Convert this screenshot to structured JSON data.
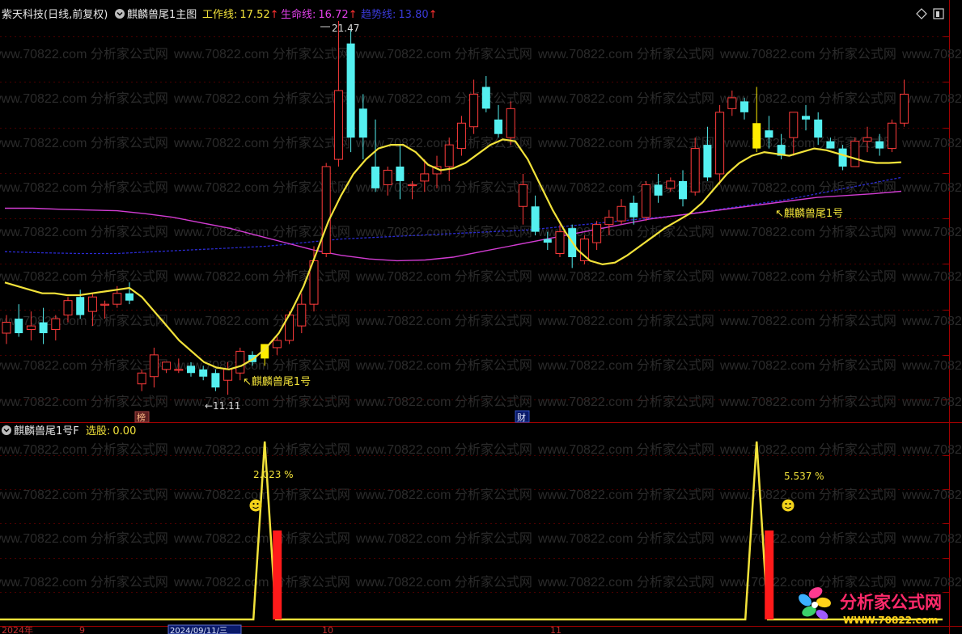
{
  "main_panel": {
    "stock": "紫天科技(日线,前复权)",
    "indicator": "麒麟兽尾1主图",
    "work_line": {
      "label": "工作线:",
      "value": "17.52",
      "arrow": "↑",
      "color": "#f2e23a"
    },
    "life_line": {
      "label": "生命线:",
      "value": "16.72",
      "arrow": "↑",
      "color": "#e040e8"
    },
    "trend_line": {
      "label": "趋势线:",
      "value": "13.80",
      "arrow": "↑",
      "color": "#3a3ad8"
    },
    "high_marker": "21.47",
    "low_marker": "←11.11",
    "signal_labels": [
      "↖麒麟兽尾1号",
      "↖麒麟兽尾1号"
    ],
    "event_tags": [
      "榜",
      "财"
    ]
  },
  "sub_panel": {
    "indicator": "麒麟兽尾1号F",
    "select_label": "选股:",
    "select_value": "0.00",
    "peak_labels": [
      "2.023 %",
      "5.537 %"
    ]
  },
  "time_axis": {
    "labels": [
      "2024年",
      "9",
      "2024/09/11/三",
      "10",
      "11"
    ]
  },
  "watermark": "www.70822.com 分析家公式网",
  "logo": {
    "title": "分析家公式网",
    "url": "WWW.70822.com"
  },
  "toolbar_icons": [
    "diamond-icon",
    "window-icon"
  ],
  "colors": {
    "up": "#ff3b3b",
    "down": "#54f0f0",
    "signal": "#ffee00",
    "work": "#f2e23a",
    "life": "#d23cd2",
    "trend": "#2a2ad0",
    "bar": "#ff1a1a"
  },
  "chart_data": {
    "type": "candlestick",
    "price_markers": {
      "high": 21.47,
      "low": 11.11
    },
    "candles": [
      {
        "o": 12.8,
        "h": 13.3,
        "l": 12.5,
        "c": 13.1
      },
      {
        "o": 13.2,
        "h": 13.6,
        "l": 12.7,
        "c": 12.8
      },
      {
        "o": 12.9,
        "h": 13.4,
        "l": 12.6,
        "c": 13.0
      },
      {
        "o": 13.1,
        "h": 13.5,
        "l": 12.5,
        "c": 12.8
      },
      {
        "o": 12.9,
        "h": 13.3,
        "l": 12.6,
        "c": 13.2
      },
      {
        "o": 13.3,
        "h": 13.8,
        "l": 13.1,
        "c": 13.7
      },
      {
        "o": 13.8,
        "h": 14.0,
        "l": 13.2,
        "c": 13.3
      },
      {
        "o": 13.4,
        "h": 13.9,
        "l": 13.0,
        "c": 13.8
      },
      {
        "o": 13.6,
        "h": 13.7,
        "l": 13.2,
        "c": 13.6
      },
      {
        "o": 13.6,
        "h": 14.1,
        "l": 13.5,
        "c": 13.9
      },
      {
        "o": 13.9,
        "h": 14.2,
        "l": 13.6,
        "c": 13.7
      },
      {
        "o": 11.4,
        "h": 11.8,
        "l": 11.2,
        "c": 11.7
      },
      {
        "o": 11.6,
        "h": 12.4,
        "l": 11.3,
        "c": 12.2
      },
      {
        "o": 11.8,
        "h": 12.0,
        "l": 11.7,
        "c": 12.0
      },
      {
        "o": 11.8,
        "h": 12.1,
        "l": 11.7,
        "c": 11.8
      },
      {
        "o": 11.9,
        "h": 12.0,
        "l": 11.6,
        "c": 11.7
      },
      {
        "o": 11.8,
        "h": 11.9,
        "l": 11.5,
        "c": 11.6
      },
      {
        "o": 11.7,
        "h": 11.8,
        "l": 11.2,
        "c": 11.3
      },
      {
        "o": 11.5,
        "h": 12.0,
        "l": 11.1,
        "c": 11.8
      },
      {
        "o": 11.7,
        "h": 12.4,
        "l": 11.5,
        "c": 12.3
      },
      {
        "o": 12.2,
        "h": 12.3,
        "l": 11.9,
        "c": 12.0
      },
      {
        "o": 12.1,
        "h": 12.5,
        "l": 11.9,
        "c": 12.5
      },
      {
        "o": 12.4,
        "h": 12.7,
        "l": 12.2,
        "c": 12.6
      },
      {
        "o": 12.6,
        "h": 13.4,
        "l": 12.5,
        "c": 13.3
      },
      {
        "o": 13.0,
        "h": 13.9,
        "l": 12.8,
        "c": 13.6
      },
      {
        "o": 13.6,
        "h": 15.2,
        "l": 13.4,
        "c": 14.8
      },
      {
        "o": 15.0,
        "h": 17.5,
        "l": 14.9,
        "c": 17.4
      },
      {
        "o": 17.6,
        "h": 21.47,
        "l": 17.4,
        "c": 19.5
      },
      {
        "o": 20.8,
        "h": 21.2,
        "l": 17.8,
        "c": 18.2
      },
      {
        "o": 19.0,
        "h": 19.4,
        "l": 17.6,
        "c": 18.2
      },
      {
        "o": 17.4,
        "h": 18.7,
        "l": 16.7,
        "c": 16.8
      },
      {
        "o": 16.9,
        "h": 17.4,
        "l": 16.6,
        "c": 17.3
      },
      {
        "o": 17.4,
        "h": 18.0,
        "l": 16.5,
        "c": 17.0
      },
      {
        "o": 16.9,
        "h": 17.0,
        "l": 16.5,
        "c": 16.9
      },
      {
        "o": 17.0,
        "h": 17.6,
        "l": 16.7,
        "c": 17.2
      },
      {
        "o": 17.2,
        "h": 17.7,
        "l": 16.8,
        "c": 17.4
      },
      {
        "o": 17.4,
        "h": 18.2,
        "l": 17.0,
        "c": 18.0
      },
      {
        "o": 17.9,
        "h": 18.8,
        "l": 17.7,
        "c": 18.6
      },
      {
        "o": 18.5,
        "h": 19.8,
        "l": 18.3,
        "c": 19.4
      },
      {
        "o": 19.6,
        "h": 19.9,
        "l": 18.9,
        "c": 19.0
      },
      {
        "o": 18.7,
        "h": 19.1,
        "l": 18.2,
        "c": 18.3
      },
      {
        "o": 18.2,
        "h": 19.2,
        "l": 18.0,
        "c": 19.0
      },
      {
        "o": 16.3,
        "h": 17.2,
        "l": 15.8,
        "c": 16.9
      },
      {
        "o": 16.3,
        "h": 16.6,
        "l": 15.5,
        "c": 15.6
      },
      {
        "o": 15.4,
        "h": 15.6,
        "l": 15.1,
        "c": 15.3
      },
      {
        "o": 15.0,
        "h": 15.8,
        "l": 14.9,
        "c": 15.6
      },
      {
        "o": 15.7,
        "h": 15.8,
        "l": 14.6,
        "c": 14.9
      },
      {
        "o": 14.8,
        "h": 15.5,
        "l": 14.7,
        "c": 15.4
      },
      {
        "o": 15.3,
        "h": 15.9,
        "l": 15.1,
        "c": 15.8
      },
      {
        "o": 15.8,
        "h": 16.2,
        "l": 15.5,
        "c": 16.0
      },
      {
        "o": 15.9,
        "h": 16.5,
        "l": 15.8,
        "c": 16.3
      },
      {
        "o": 16.4,
        "h": 16.6,
        "l": 15.8,
        "c": 16.0
      },
      {
        "o": 16.0,
        "h": 17.0,
        "l": 15.9,
        "c": 16.9
      },
      {
        "o": 16.9,
        "h": 17.2,
        "l": 16.4,
        "c": 16.6
      },
      {
        "o": 16.8,
        "h": 17.1,
        "l": 16.7,
        "c": 17.0
      },
      {
        "o": 17.0,
        "h": 17.3,
        "l": 16.3,
        "c": 16.5
      },
      {
        "o": 16.7,
        "h": 18.2,
        "l": 16.6,
        "c": 17.9
      },
      {
        "o": 18.0,
        "h": 18.5,
        "l": 17.0,
        "c": 17.1
      },
      {
        "o": 17.2,
        "h": 19.1,
        "l": 16.9,
        "c": 18.9
      },
      {
        "o": 19.0,
        "h": 19.5,
        "l": 18.8,
        "c": 19.3
      },
      {
        "o": 19.2,
        "h": 19.3,
        "l": 18.7,
        "c": 18.9
      },
      {
        "o": 18.6,
        "h": 19.6,
        "l": 17.8,
        "c": 17.9
      },
      {
        "o": 18.4,
        "h": 18.8,
        "l": 17.9,
        "c": 18.2
      },
      {
        "o": 18.0,
        "h": 18.3,
        "l": 17.6,
        "c": 17.7
      },
      {
        "o": 18.2,
        "h": 18.9,
        "l": 17.7,
        "c": 18.9
      },
      {
        "o": 18.8,
        "h": 19.1,
        "l": 18.4,
        "c": 18.7
      },
      {
        "o": 18.7,
        "h": 18.9,
        "l": 18.0,
        "c": 18.2
      },
      {
        "o": 18.1,
        "h": 18.2,
        "l": 17.9,
        "c": 17.9
      },
      {
        "o": 17.9,
        "h": 18.0,
        "l": 17.3,
        "c": 17.4
      },
      {
        "o": 17.4,
        "h": 18.2,
        "l": 17.4,
        "c": 18.1
      },
      {
        "o": 18.1,
        "h": 18.5,
        "l": 17.8,
        "c": 18.2
      },
      {
        "o": 18.1,
        "h": 18.3,
        "l": 17.7,
        "c": 17.9
      },
      {
        "o": 17.9,
        "h": 18.7,
        "l": 17.8,
        "c": 18.6
      },
      {
        "o": 18.6,
        "h": 19.8,
        "l": 18.5,
        "c": 19.4
      }
    ],
    "signal_candle_indices": [
      21,
      61
    ],
    "work_line": [
      14.2,
      14.1,
      14.0,
      13.9,
      13.9,
      13.85,
      13.85,
      13.9,
      13.95,
      14.0,
      14.05,
      13.8,
      13.4,
      13.0,
      12.6,
      12.3,
      12.0,
      11.85,
      11.8,
      11.9,
      12.1,
      12.4,
      12.8,
      13.4,
      14.1,
      15.0,
      15.9,
      16.6,
      17.2,
      17.6,
      17.9,
      18.0,
      18.0,
      17.8,
      17.45,
      17.3,
      17.35,
      17.5,
      17.75,
      18.0,
      18.15,
      18.1,
      17.6,
      16.9,
      16.2,
      15.6,
      15.1,
      14.8,
      14.7,
      14.75,
      14.95,
      15.2,
      15.45,
      15.7,
      15.9,
      16.1,
      16.4,
      16.8,
      17.2,
      17.5,
      17.7,
      17.8,
      17.75,
      17.7,
      17.8,
      17.9,
      17.85,
      17.75,
      17.65,
      17.55,
      17.5,
      17.5,
      17.52
    ],
    "life_line": [
      16.25,
      16.25,
      16.22,
      16.2,
      16.18,
      16.1,
      16.0,
      15.85,
      15.7,
      15.5,
      15.3,
      15.1,
      14.95,
      14.85,
      14.8,
      14.82,
      14.9,
      15.05,
      15.2,
      15.35,
      15.5,
      15.65,
      15.8,
      15.95,
      16.05,
      16.15,
      16.25,
      16.35,
      16.45,
      16.55,
      16.6,
      16.65,
      16.72
    ],
    "trend_line": [
      15.05,
      15.02,
      15.0,
      15.0,
      15.05,
      15.1,
      15.15,
      15.2,
      15.3,
      15.4,
      15.45,
      15.5,
      15.55,
      15.6,
      15.65,
      15.75,
      15.85,
      15.95,
      16.05,
      16.2,
      16.35,
      16.5,
      16.7,
      16.9,
      17.1
    ],
    "sub_chart": {
      "series": "选股",
      "peaks": [
        2.023,
        5.537
      ],
      "peak_indices": [
        21,
        61
      ],
      "ylim": [
        0,
        1
      ]
    }
  }
}
